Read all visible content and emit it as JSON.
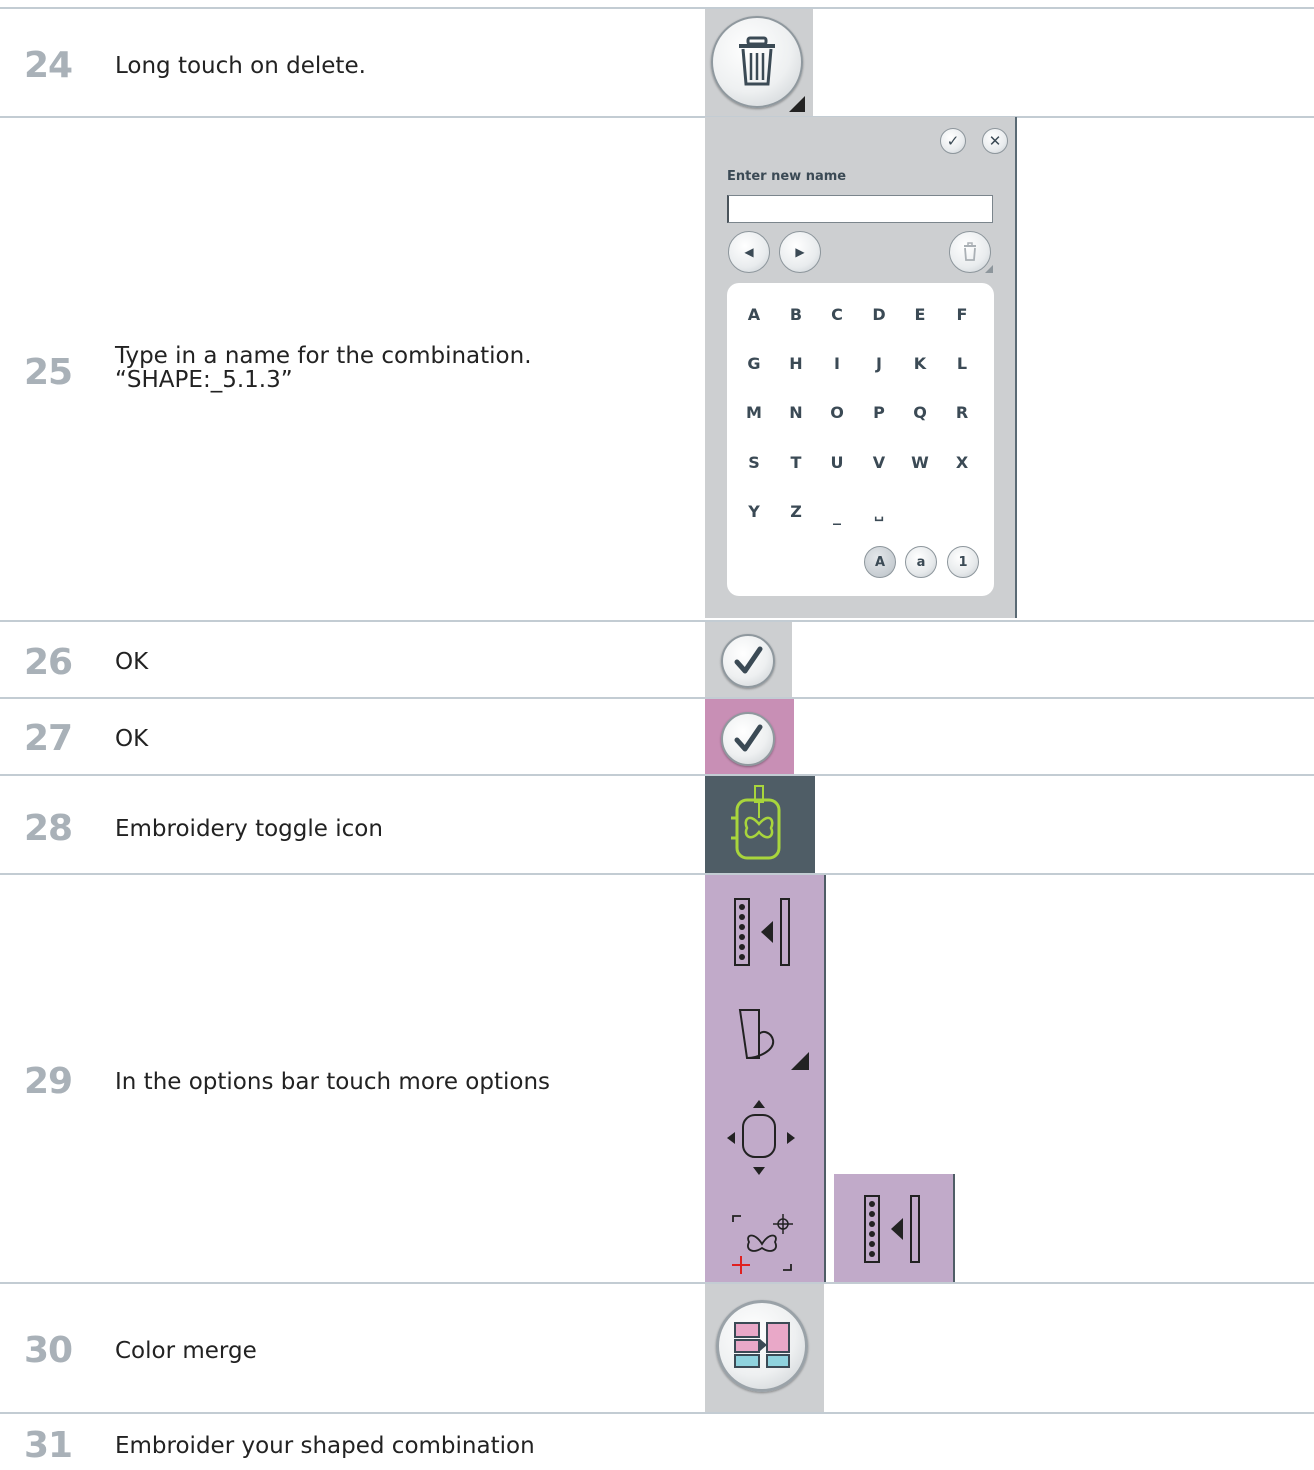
{
  "steps": [
    {
      "number": "24",
      "text": "Long touch on delete."
    },
    {
      "number": "25",
      "text": "Type in a name for the combination.\n“SHAPE:_5.1.3”"
    },
    {
      "number": "26",
      "text": "OK"
    },
    {
      "number": "27",
      "text": "OK"
    },
    {
      "number": "28",
      "text": "Embroidery toggle icon"
    },
    {
      "number": "29",
      "text": "In the options bar touch more options"
    },
    {
      "number": "30",
      "text": "Color merge"
    },
    {
      "number": "31",
      "text": "Embroider your shaped combination"
    }
  ],
  "keyboard": {
    "prompt": "Enter new name",
    "input_value": "",
    "rows": [
      [
        "A",
        "B",
        "C",
        "D",
        "E",
        "F"
      ],
      [
        "G",
        "H",
        "I",
        "J",
        "K",
        "L"
      ],
      [
        "M",
        "N",
        "O",
        "P",
        "Q",
        "R"
      ],
      [
        "S",
        "T",
        "U",
        "V",
        "W",
        "X"
      ],
      [
        "Y",
        "Z",
        "_",
        "␣"
      ]
    ],
    "modes": [
      "A",
      "a",
      "1"
    ]
  },
  "icons": {
    "step24": "delete-icon",
    "step25": [
      "confirm-icon",
      "close-icon",
      "arrow-left-icon",
      "arrow-right-icon",
      "delete-icon"
    ],
    "step26": "ok-icon",
    "step27": "ok-icon",
    "step28": "embroidery-toggle-icon",
    "step29": [
      "more-options-icon",
      "shape-icon",
      "move-to-hoop-icon",
      "position-icon",
      "more-options-icon"
    ],
    "step30": "color-merge-icon"
  },
  "colors": {
    "number": "#a9b1b8",
    "divider": "#c3ccd3",
    "panel_gray": "#cdcfd1",
    "panel_pink": "#c88fb5",
    "panel_lilac": "#c1aac9",
    "panel_slate": "#4f5d66",
    "embroidery_green": "#a8d53c"
  }
}
